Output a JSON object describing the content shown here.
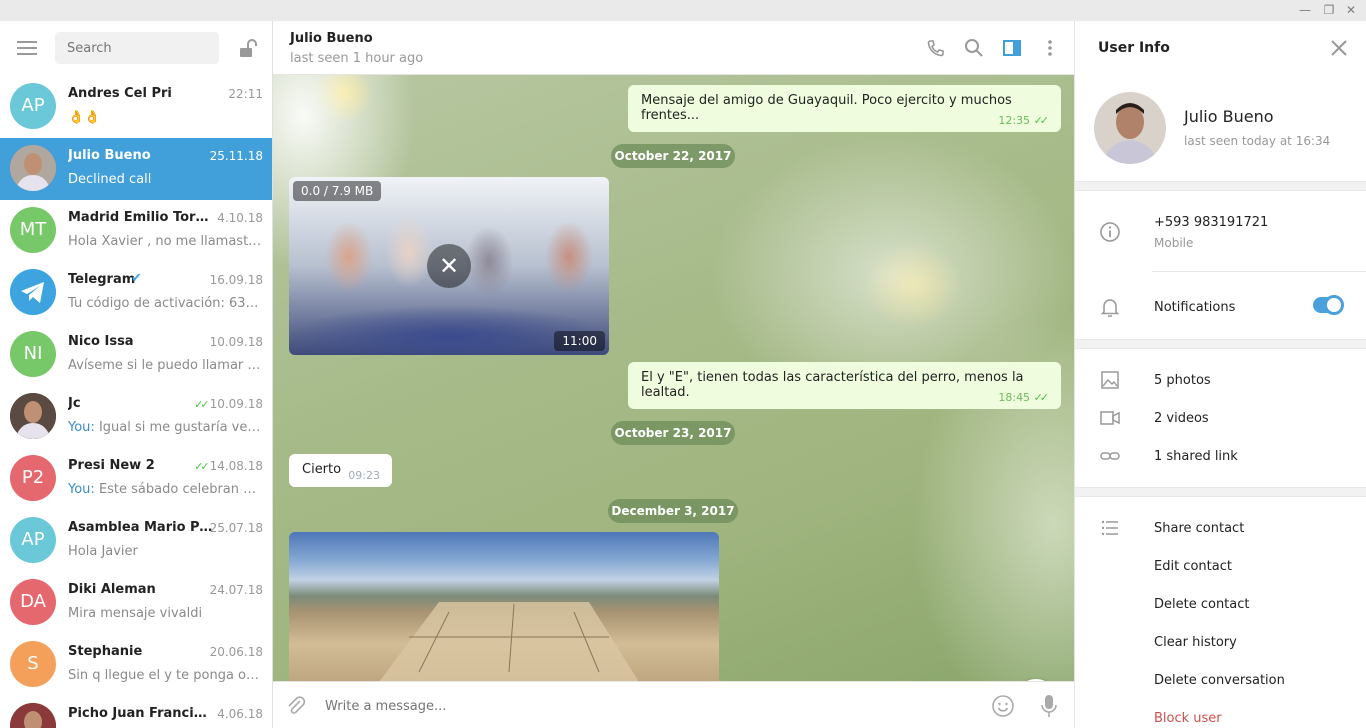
{
  "sidebar": {
    "search_placeholder": "Search",
    "chats": [
      {
        "name": "Andres Cel Pri",
        "date": "22:11",
        "message": "👌👌",
        "initials": "AP",
        "color": "#6ac8d8",
        "you": ""
      },
      {
        "name": "Julio Bueno",
        "date": "25.11.18",
        "message": "Declined call",
        "initials": "",
        "color": "#b0a79e",
        "you": ""
      },
      {
        "name": "Madrid Emilio Torres",
        "date": "4.10.18",
        "message": "Hola Xavier , no me llamaste y ...",
        "initials": "MT",
        "color": "#77c868",
        "you": ""
      },
      {
        "name": "Telegram",
        "date": "16.09.18",
        "message": "Tu código de activación: 63664 ...",
        "initials": "",
        "color": "#3ea4e0",
        "you": ""
      },
      {
        "name": "Nico Issa",
        "date": "10.09.18",
        "message": "Avíseme si le puedo llamar por ...",
        "initials": "NI",
        "color": "#77c868",
        "you": ""
      },
      {
        "name": "Jc",
        "date": "10.09.18",
        "message": "Igual si me gustaría verlo s...",
        "initials": "",
        "color": "#5a4a42",
        "you": "You:"
      },
      {
        "name": "Presi New 2",
        "date": "14.08.18",
        "message": "Este sábado celebran 4 a...",
        "initials": "P2",
        "color": "#e5686f",
        "you": "You:"
      },
      {
        "name": "Asamblea Mario Paz...",
        "date": "25.07.18",
        "message": "Hola Javier",
        "initials": "AP",
        "color": "#6ac8d8",
        "you": ""
      },
      {
        "name": "Diki Aleman",
        "date": "24.07.18",
        "message": "Mira mensaje vivaldi",
        "initials": "DA",
        "color": "#e5686f",
        "you": ""
      },
      {
        "name": "Stephanie",
        "date": "20.06.18",
        "message": "Sin q llegue el y te ponga obstá...",
        "initials": "S",
        "color": "#f5a05a",
        "you": ""
      },
      {
        "name": "Picho Juan Francisco",
        "date": "4.06.18",
        "message": "",
        "initials": "",
        "color": "#8a3a3a",
        "you": ""
      }
    ]
  },
  "chat": {
    "name": "Julio Bueno",
    "status": "last seen 1 hour ago",
    "messages": {
      "m1_text": "Mensaje del amigo de Guayaquil. Poco ejercito y muchos frentes...",
      "m1_time": "12:35",
      "date1": "October 22, 2017",
      "video_size": "0.0 / 7.9 MB",
      "video_duration": "11:00",
      "m2_text": "El y \"E\", tienen todas las característica del perro, menos la lealtad.",
      "m2_time": "18:45",
      "date2": "October 23, 2017",
      "m3_text": "Cierto",
      "m3_time": "09:23",
      "date3": "December 3, 2017"
    },
    "composer_placeholder": "Write a message..."
  },
  "info": {
    "title": "User Info",
    "name": "Julio Bueno",
    "last_seen": "last seen today at 16:34",
    "phone": "+593 983191721",
    "phone_label": "Mobile",
    "notifications": "Notifications",
    "notifications_on": true,
    "photos": "5 photos",
    "videos": "2 videos",
    "links": "1 shared link",
    "actions": [
      "Share contact",
      "Edit contact",
      "Delete contact",
      "Clear history",
      "Delete conversation",
      "Block user"
    ]
  },
  "colors": {
    "accent": "#419fd9",
    "outgoing": "#effdde",
    "tick": "#4dc247",
    "danger": "#d14e4e"
  }
}
